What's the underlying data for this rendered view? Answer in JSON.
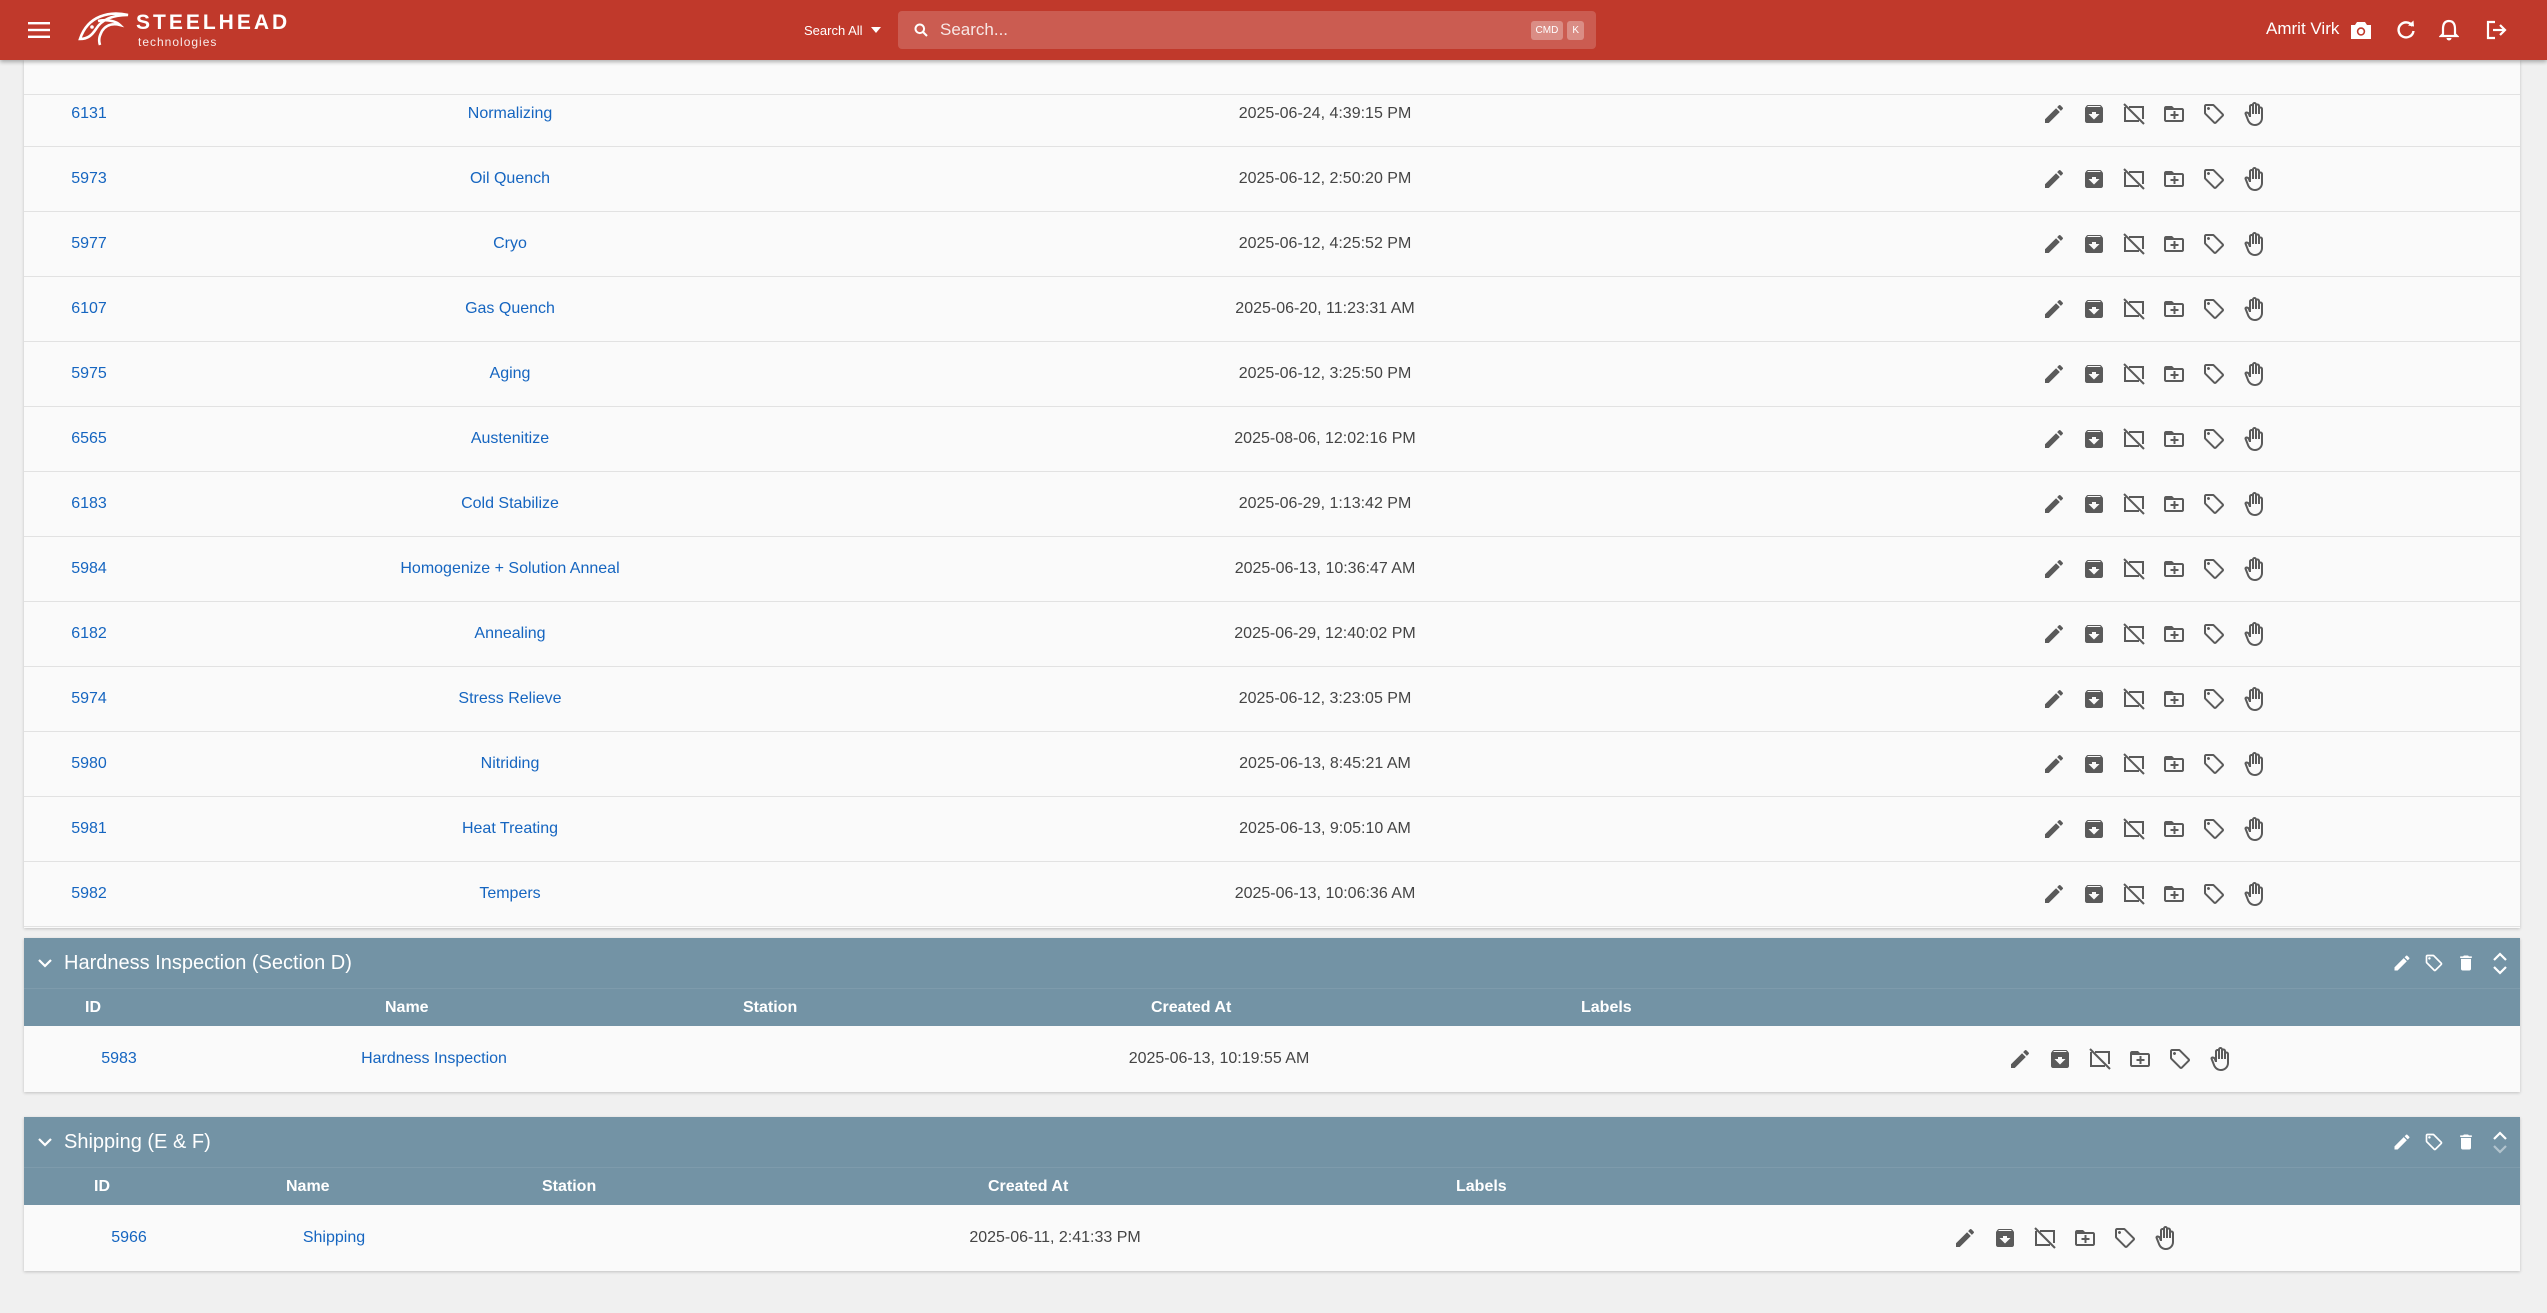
{
  "header": {
    "brand_name": "STEELHEAD",
    "brand_sub": "technologies",
    "search_scope": "Search All",
    "search_placeholder": "Search...",
    "shortcut_keys": [
      "CMD",
      "K"
    ],
    "user_name": "Amrit Virk"
  },
  "rows": [
    {
      "id": "6131",
      "name": "Normalizing",
      "created_at": "2025-06-24, 4:39:15 PM"
    },
    {
      "id": "5973",
      "name": "Oil Quench",
      "created_at": "2025-06-12, 2:50:20 PM"
    },
    {
      "id": "5977",
      "name": "Cryo",
      "created_at": "2025-06-12, 4:25:52 PM"
    },
    {
      "id": "6107",
      "name": "Gas Quench",
      "created_at": "2025-06-20, 11:23:31 AM"
    },
    {
      "id": "5975",
      "name": "Aging",
      "created_at": "2025-06-12, 3:25:50 PM"
    },
    {
      "id": "6565",
      "name": "Austenitize",
      "created_at": "2025-08-06, 12:02:16 PM"
    },
    {
      "id": "6183",
      "name": "Cold Stabilize",
      "created_at": "2025-06-29, 1:13:42 PM"
    },
    {
      "id": "5984",
      "name": "Homogenize + Solution Anneal",
      "created_at": "2025-06-13, 10:36:47 AM"
    },
    {
      "id": "6182",
      "name": "Annealing",
      "created_at": "2025-06-29, 12:40:02 PM"
    },
    {
      "id": "5974",
      "name": "Stress Relieve",
      "created_at": "2025-06-12, 3:23:05 PM"
    },
    {
      "id": "5980",
      "name": "Nitriding",
      "created_at": "2025-06-13, 8:45:21 AM"
    },
    {
      "id": "5981",
      "name": "Heat Treating",
      "created_at": "2025-06-13, 9:05:10 AM"
    },
    {
      "id": "5982",
      "name": "Tempers",
      "created_at": "2025-06-13, 10:06:36 AM"
    }
  ],
  "groups": [
    {
      "title": "Hardness Inspection (Section D)",
      "columns": [
        "ID",
        "Name",
        "Station",
        "Created At",
        "Labels"
      ],
      "rows": [
        {
          "id": "5983",
          "name": "Hardness Inspection",
          "created_at": "2025-06-13, 10:19:55 AM"
        }
      ]
    },
    {
      "title": "Shipping (E & F)",
      "columns": [
        "ID",
        "Name",
        "Station",
        "Created At",
        "Labels"
      ],
      "rows": [
        {
          "id": "5966",
          "name": "Shipping",
          "created_at": "2025-06-11, 2:41:33 PM"
        }
      ]
    }
  ],
  "colors": {
    "topbar": "#c0392b",
    "group_header": "#7393a5",
    "link": "#1565c0"
  },
  "row_action_icons": [
    "pencil-icon",
    "archive-icon",
    "hide-icon",
    "move-to-folder-icon",
    "tag-icon",
    "hand-icon"
  ]
}
